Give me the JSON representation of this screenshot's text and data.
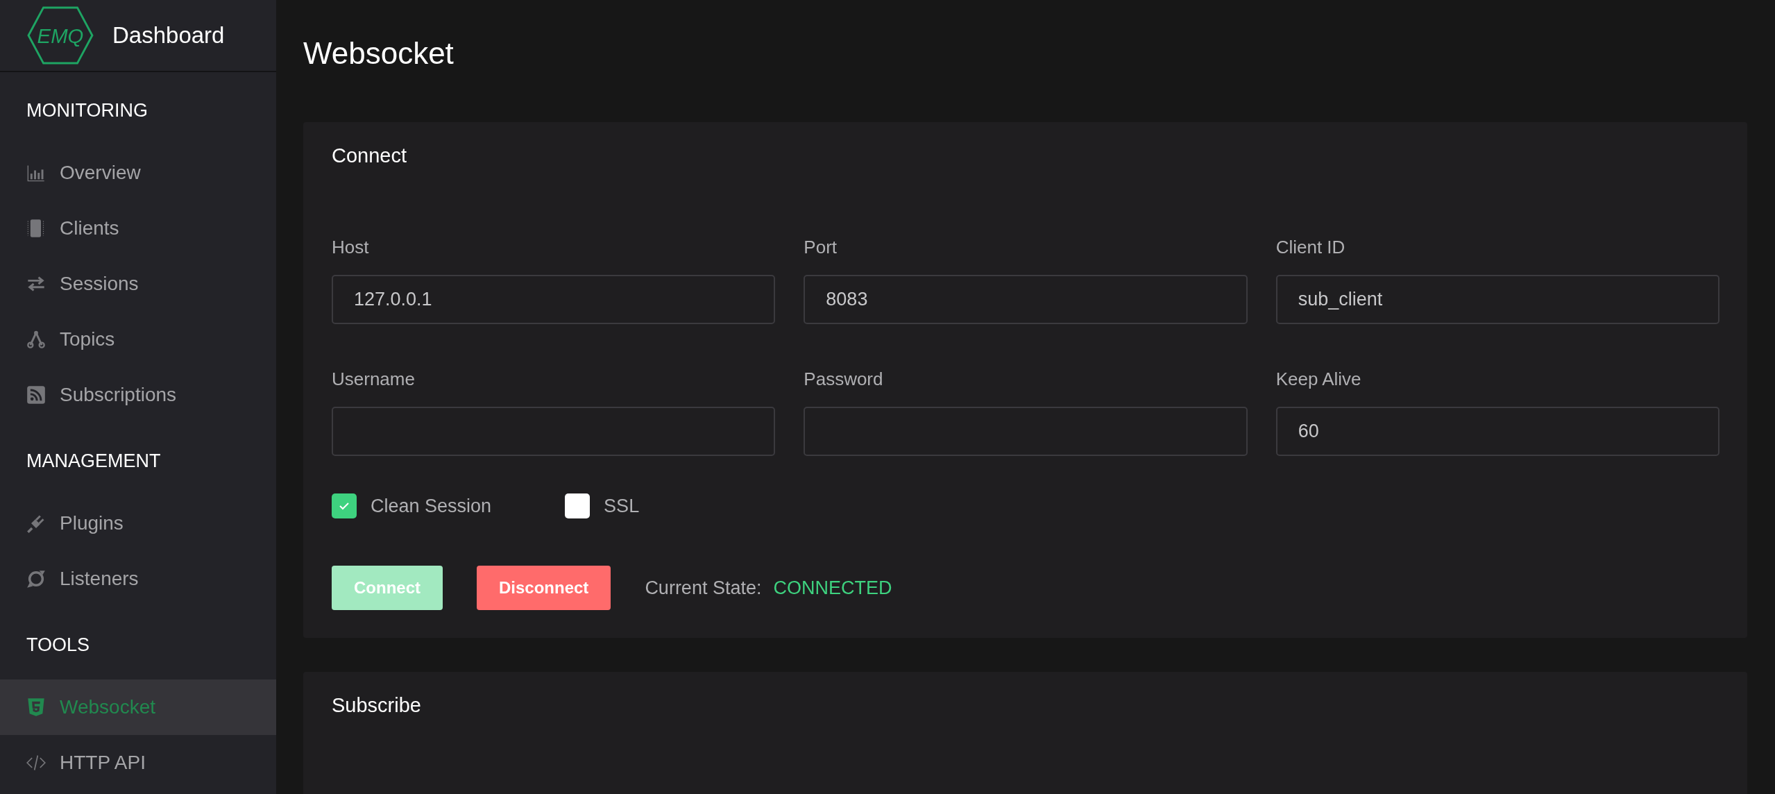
{
  "sidebar": {
    "logo": "EMQ",
    "title": "Dashboard",
    "sections": [
      {
        "heading": "MONITORING",
        "items": [
          {
            "label": "Overview",
            "kind": "chart",
            "selected": false
          },
          {
            "label": "Clients",
            "kind": "chip",
            "selected": false
          },
          {
            "label": "Sessions",
            "kind": "swap",
            "selected": false
          },
          {
            "label": "Topics",
            "kind": "nodes",
            "selected": false
          },
          {
            "label": "Subscriptions",
            "kind": "rss",
            "selected": false
          }
        ]
      },
      {
        "heading": "MANAGEMENT",
        "items": [
          {
            "label": "Plugins",
            "kind": "plug",
            "selected": false
          },
          {
            "label": "Listeners",
            "kind": "ring",
            "selected": false
          }
        ]
      },
      {
        "heading": "TOOLS",
        "items": [
          {
            "label": "Websocket",
            "kind": "html5",
            "selected": true
          },
          {
            "label": "HTTP API",
            "kind": "code",
            "selected": false
          }
        ]
      }
    ]
  },
  "page_title": "Websocket",
  "connect": {
    "title": "Connect",
    "fields": [
      {
        "label": "Host",
        "value": "127.0.0.1"
      },
      {
        "label": "Port",
        "value": "8083"
      },
      {
        "label": "Client ID",
        "value": "sub_client"
      },
      {
        "label": "Username"
      },
      {
        "label": "Password"
      },
      {
        "label": "Keep Alive",
        "value": "60"
      }
    ],
    "options": [
      {
        "label": "Clean Session",
        "checked": true
      },
      {
        "label": "SSL",
        "checked": false
      }
    ],
    "buttons": [
      {
        "label": "Connect",
        "kind": "primary",
        "disabled": true
      },
      {
        "label": "Disconnect",
        "kind": "danger",
        "disabled": false
      }
    ],
    "state_label": "Current State:",
    "state_value": "CONNECTED"
  },
  "subscribe": {
    "title": "Subscribe"
  }
}
